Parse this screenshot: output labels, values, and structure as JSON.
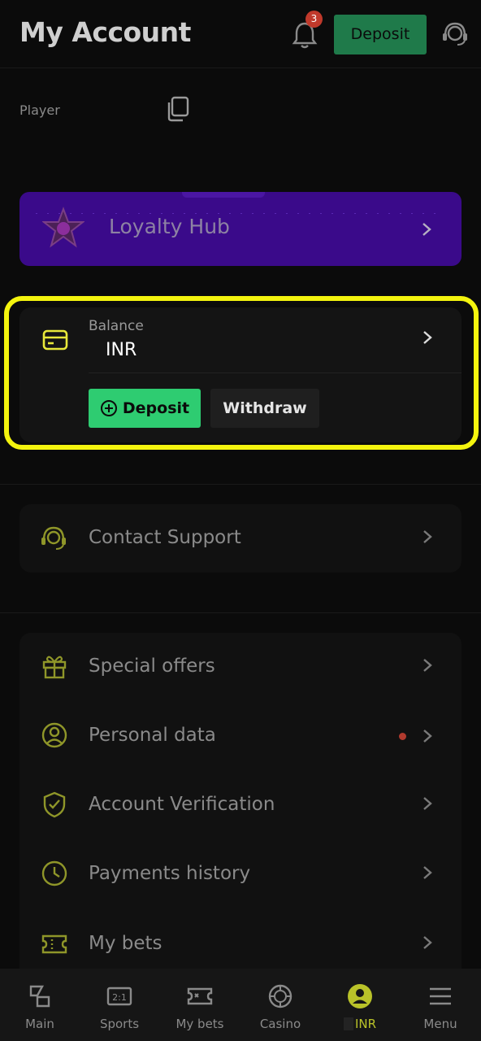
{
  "header": {
    "title": "My Account",
    "notification_count": "3",
    "deposit_label": "Deposit"
  },
  "player": {
    "label": "Player"
  },
  "loyalty": {
    "label": "Loyalty Hub"
  },
  "balance": {
    "label": "Balance",
    "currency": "INR",
    "deposit_label": "Deposit",
    "withdraw_label": "Withdraw"
  },
  "support": {
    "label": "Contact Support"
  },
  "menu": {
    "items": [
      {
        "label": "Special offers",
        "icon": "gift-icon"
      },
      {
        "label": "Personal data",
        "icon": "user-circle-icon",
        "has_dot": true
      },
      {
        "label": "Account Verification",
        "icon": "shield-check-icon"
      },
      {
        "label": "Payments history",
        "icon": "clock-icon"
      },
      {
        "label": "My bets",
        "icon": "ticket-icon"
      }
    ]
  },
  "nav": {
    "items": [
      {
        "label": "Main",
        "icon": "main-icon"
      },
      {
        "label": "Sports",
        "icon": "sports-icon"
      },
      {
        "label": "My bets",
        "icon": "ticket-icon"
      },
      {
        "label": "Casino",
        "icon": "casino-chip-icon"
      },
      {
        "label": "INR",
        "icon": "user-icon",
        "active": true
      },
      {
        "label": "Menu",
        "icon": "hamburger-icon"
      }
    ]
  },
  "colors": {
    "accent_yellow": "#b9c229",
    "deposit_green": "#2ecc71",
    "loyalty_purple": "#3a0a8a",
    "highlight_outline": "#f4f40e",
    "badge_red": "#c0392b"
  }
}
